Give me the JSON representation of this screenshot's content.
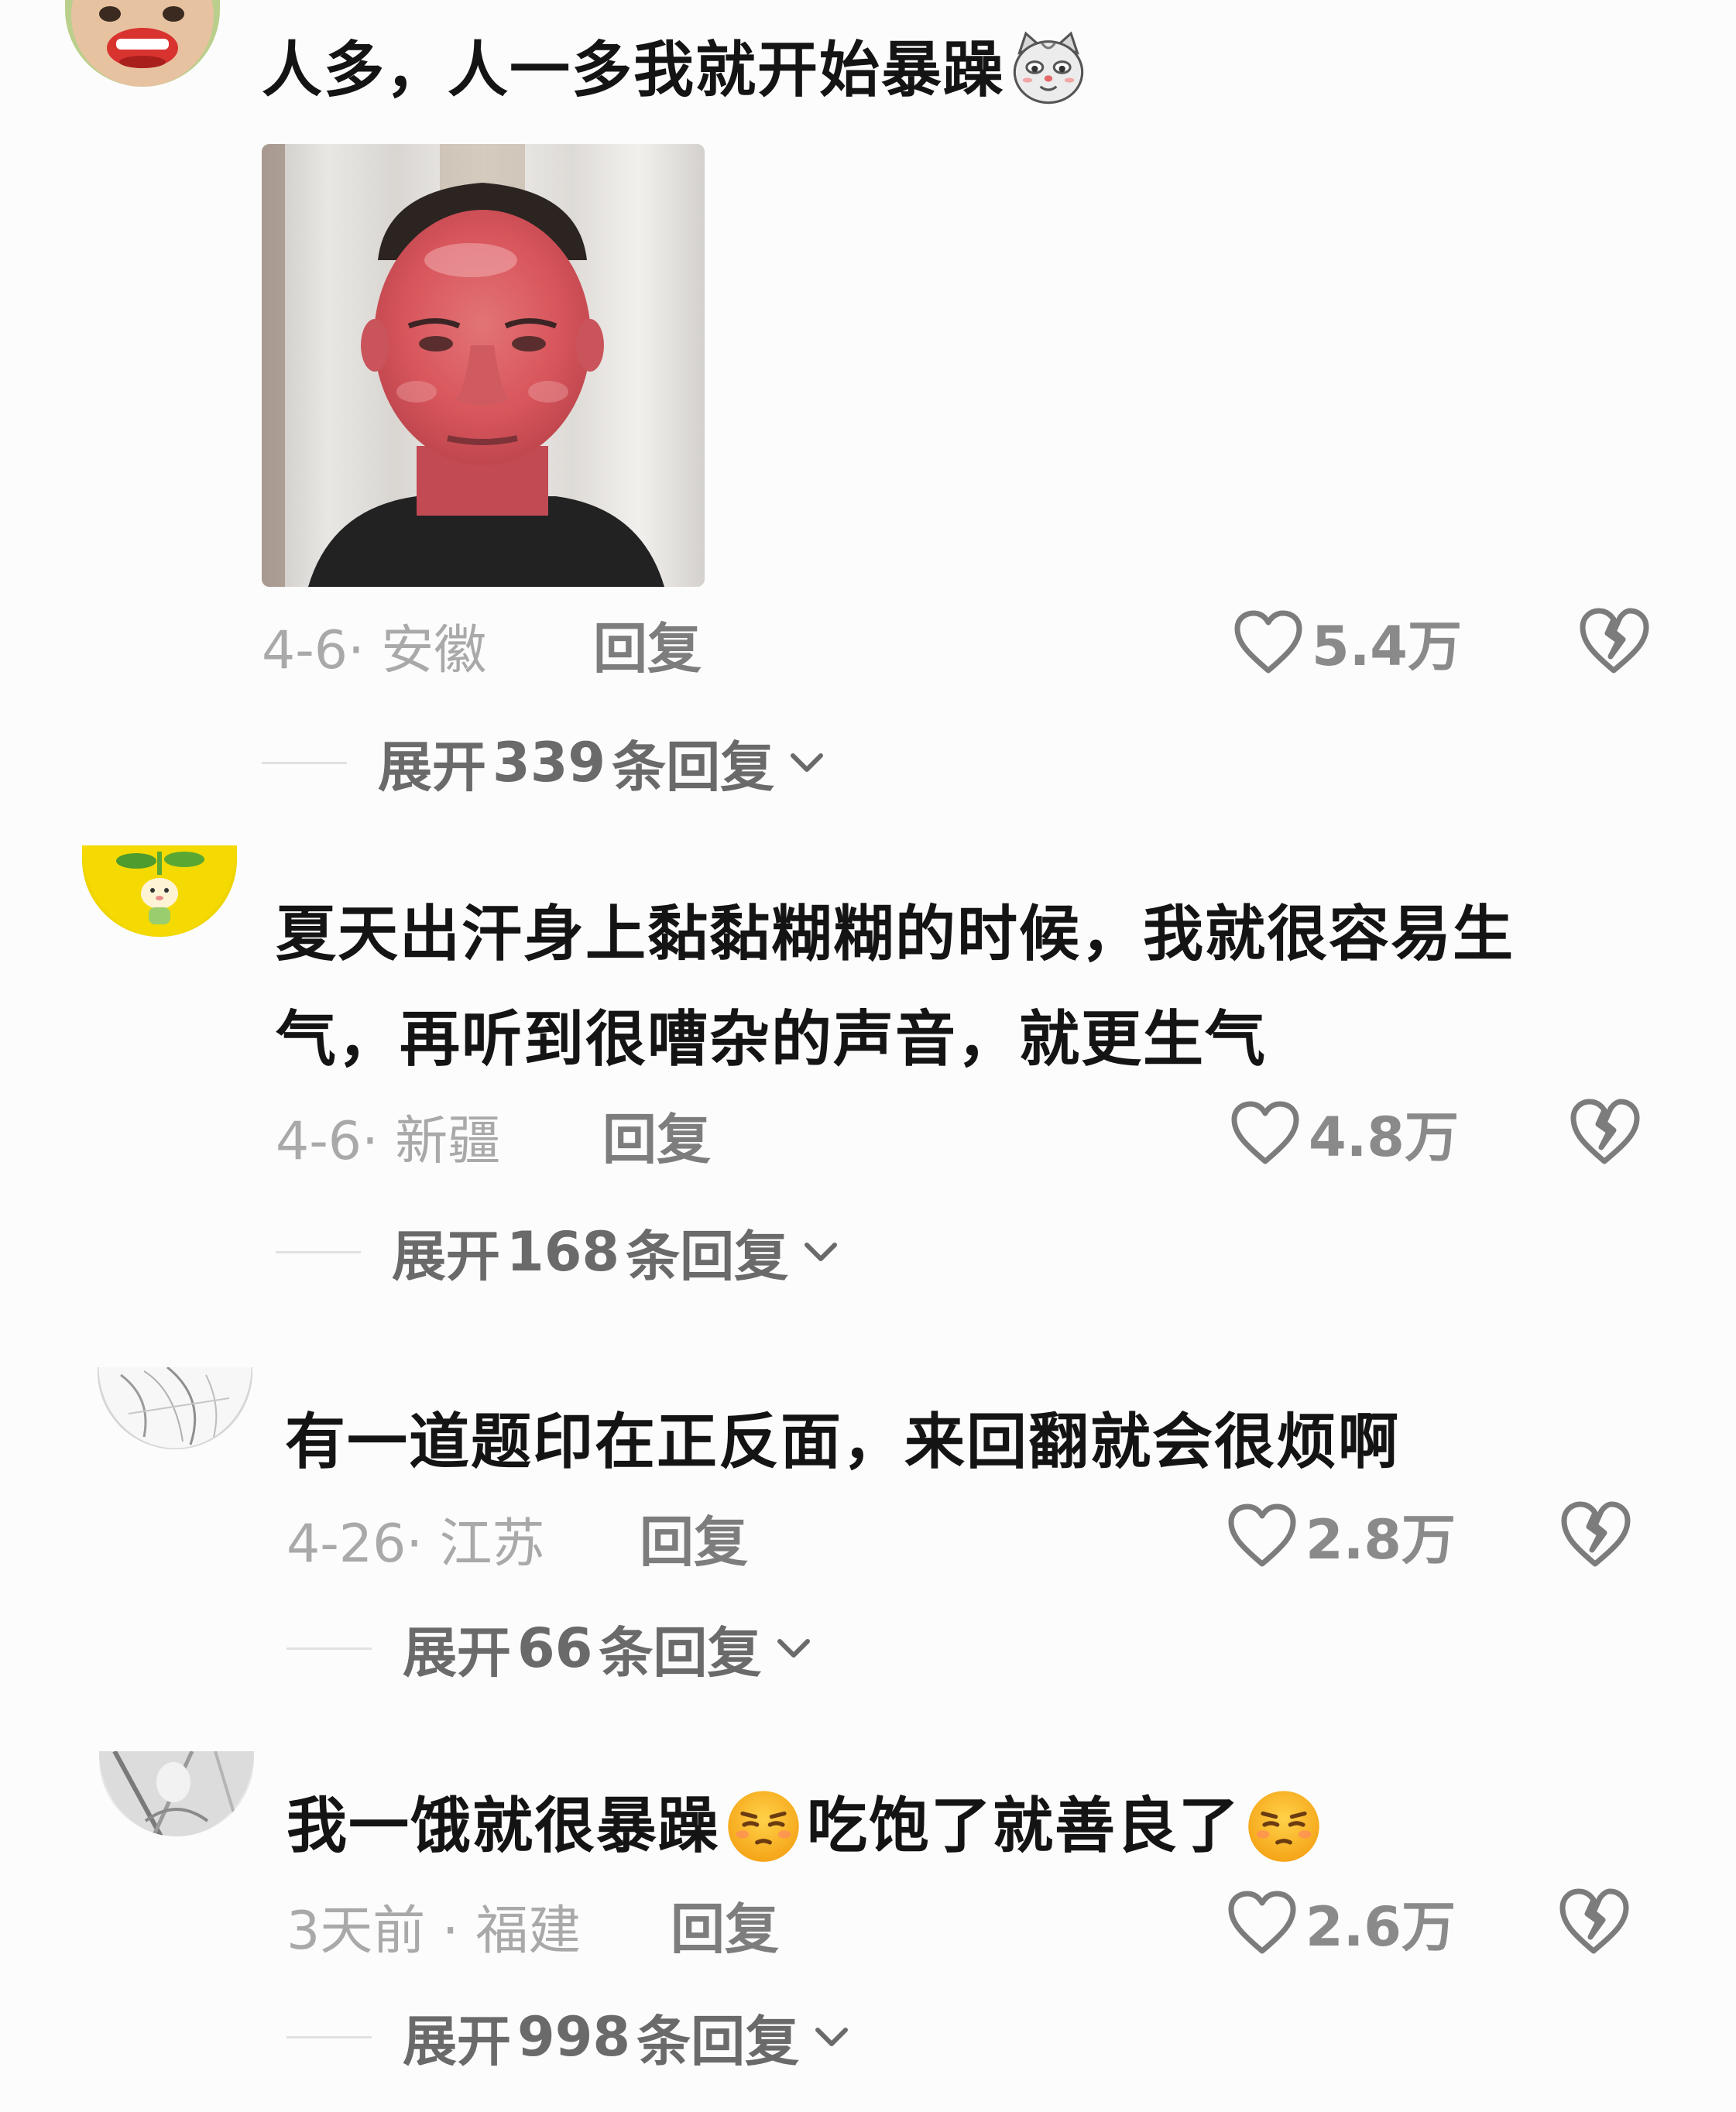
{
  "comments": [
    {
      "text_parts": [
        "人多，人一多我就开始暴躁"
      ],
      "date_location": "4-6· 安徽",
      "reply_label": "回复",
      "likes": "5.4万",
      "expand": {
        "prefix": "展开",
        "count": "339",
        "suffix": "条回复"
      },
      "emoji": "cat-smirk-emoji",
      "has_image": true
    },
    {
      "text_lines": [
        "夏天出汗身上黏黏糊糊的时候，我就很容易生",
        "气，再听到很嘈杂的声音，就更生气"
      ],
      "date_location": "4-6· 新疆",
      "reply_label": "回复",
      "likes": "4.8万",
      "expand": {
        "prefix": "展开",
        "count": "168",
        "suffix": "条回复"
      }
    },
    {
      "text_parts": [
        "有一道题印在正反面，来回翻就会很烦啊"
      ],
      "date_location": "4-26· 江苏",
      "reply_label": "回复",
      "likes": "2.8万",
      "expand": {
        "prefix": "展开",
        "count": "66",
        "suffix": "条回复"
      }
    },
    {
      "text_parts": [
        "我一饿就很暴躁",
        "吃饱了就善良了"
      ],
      "date_location": "3天前 · 福建",
      "reply_label": "回复",
      "likes": "2.6万",
      "expand": {
        "prefix": "展开",
        "count": "998",
        "suffix": "条回复"
      },
      "emoji": "annoyed-face-emoji"
    }
  ],
  "icons": {
    "like": "heart-outline-icon",
    "dislike": "broken-heart-icon",
    "expand": "chevron-down-icon"
  },
  "colors": {
    "text": "#141414",
    "meta": "#a9a9a9",
    "count": "#8a8a8a"
  }
}
